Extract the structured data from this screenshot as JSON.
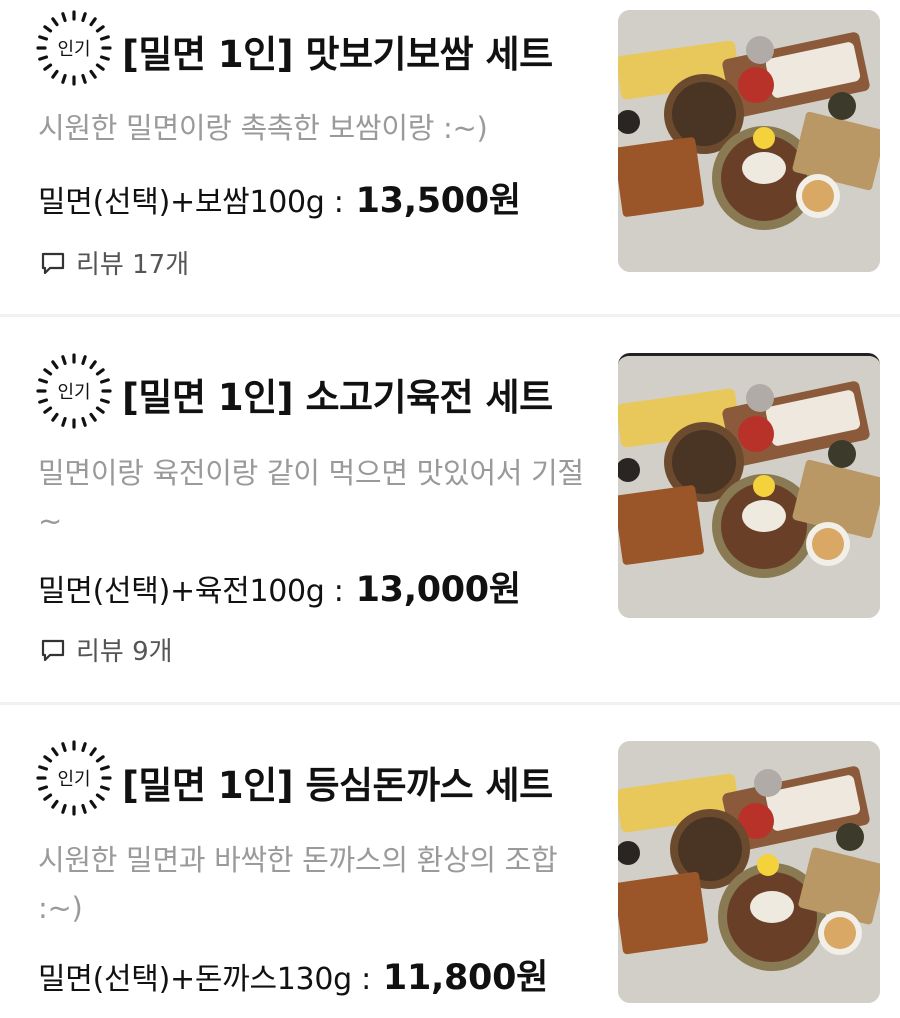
{
  "items": [
    {
      "badge": "인기",
      "title": "[밀면 1인] 맛보기보쌈 세트",
      "description": "시원한 밀면이랑 촉촉한 보쌈이랑 :~)",
      "option": "밀면(선택)+보쌈100g :",
      "price": "13,500원",
      "review": "리뷰 17개"
    },
    {
      "badge": "인기",
      "title": "[밀면 1인] 소고기육전 세트",
      "description": "밀면이랑 육전이랑 같이 먹으면 맛있어서 기절~",
      "option": "밀면(선택)+육전100g :",
      "price": "13,000원",
      "review": "리뷰 9개"
    },
    {
      "badge": "인기",
      "title": "[밀면 1인] 등심돈까스 세트",
      "description": "시원한 밀면과 바싹한 돈까스의 환상의 조합 :~)",
      "option": "밀면(선택)+돈까스130g :",
      "price": "11,800원"
    }
  ]
}
